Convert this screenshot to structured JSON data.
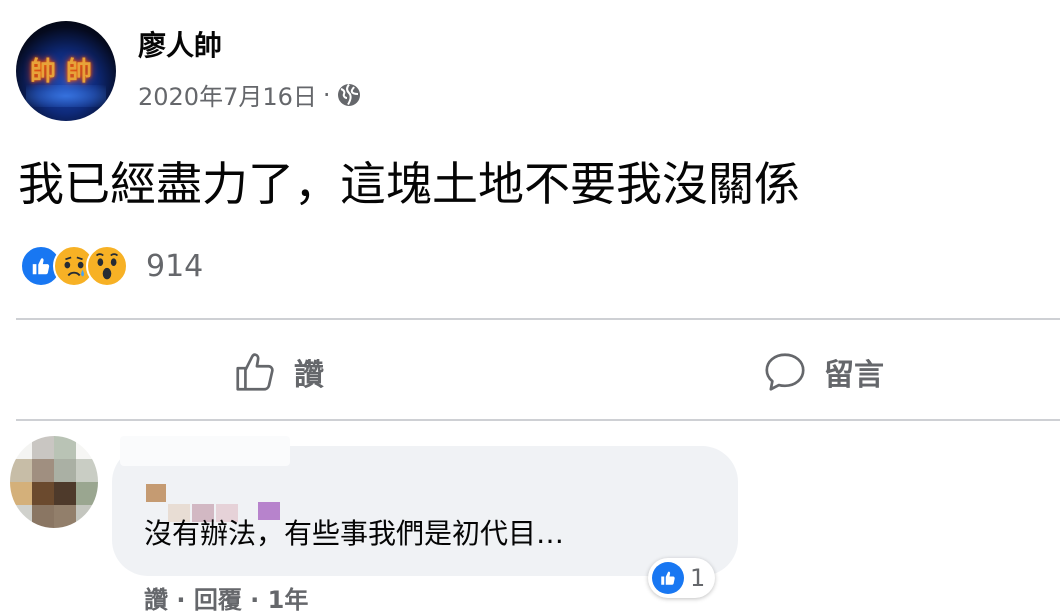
{
  "post": {
    "author": "廖人帥",
    "date": "2020年7月16日",
    "separator": "·",
    "privacy_icon": "globe-icon",
    "text": "我已經盡力了，這塊土地不要我沒關係",
    "reactions": {
      "icons": [
        "like-icon",
        "sad-icon",
        "wow-icon"
      ],
      "count": "914"
    }
  },
  "actions": {
    "like_label": "讚",
    "comment_label": "留言"
  },
  "comment": {
    "text": "沒有辦法，有些事我們是初代目…",
    "like_count": "1",
    "actions_line": "讚 · 回覆 · 1年"
  },
  "colors": {
    "brand": "#1877f2",
    "secondary_text": "#65676b",
    "bubble": "#f0f2f5"
  }
}
